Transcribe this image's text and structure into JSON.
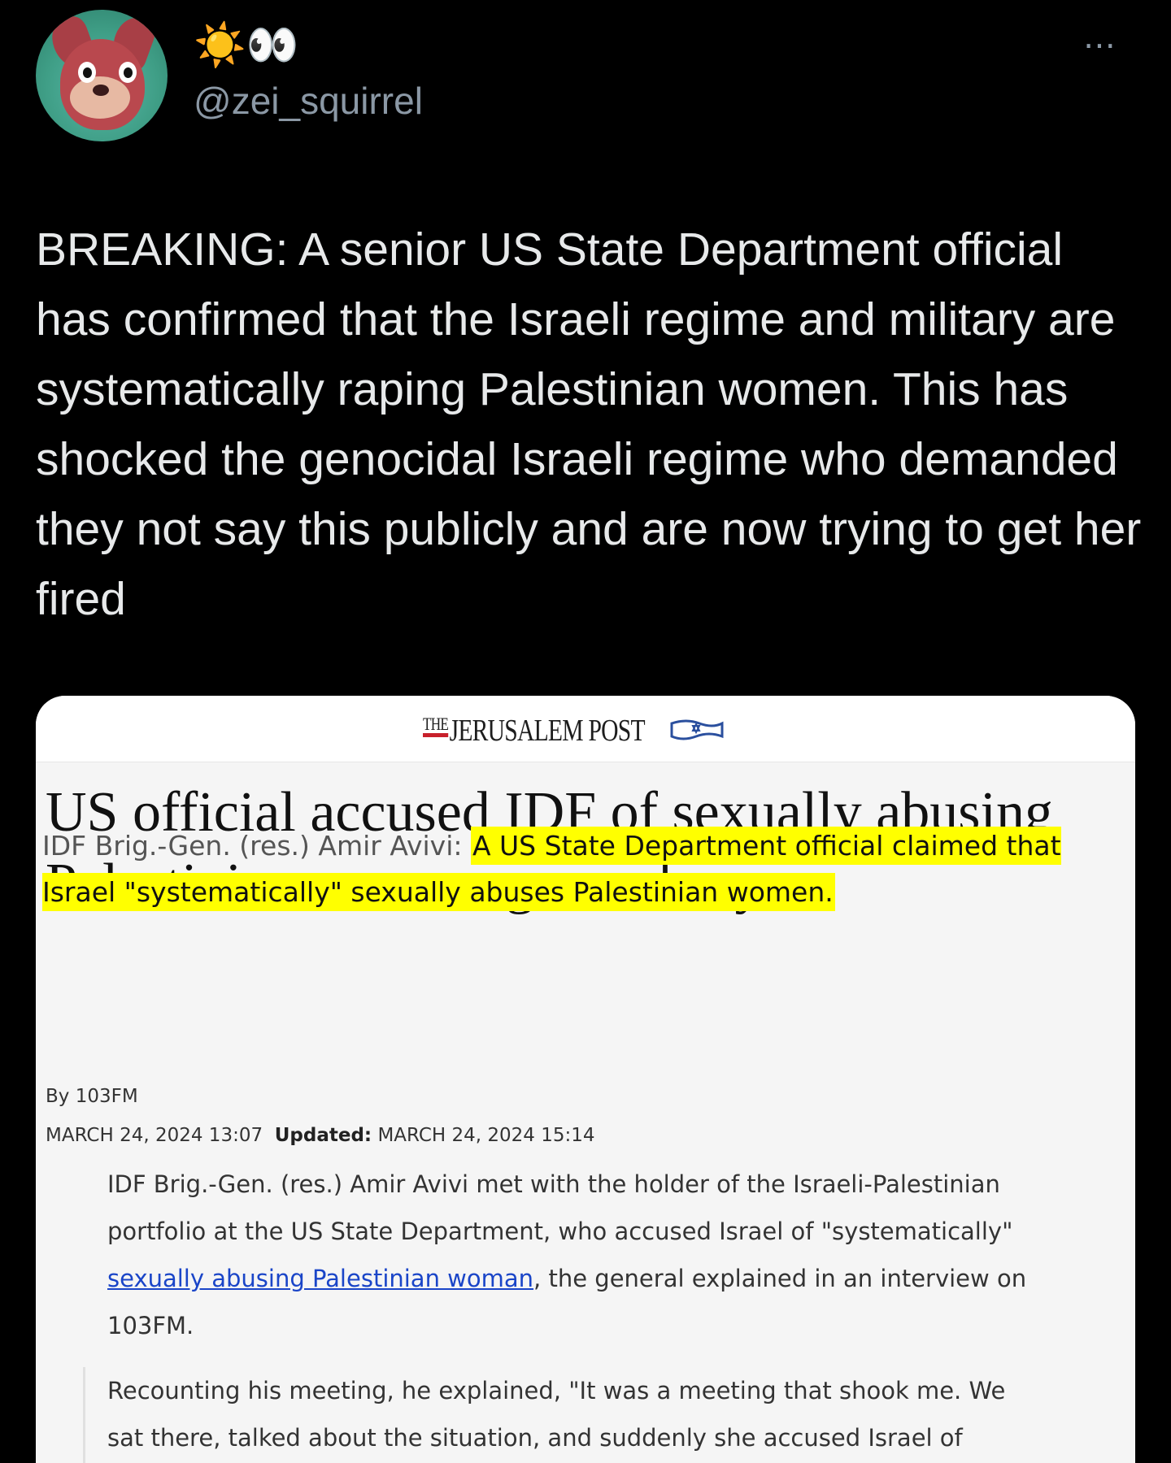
{
  "header": {
    "display_name": "☀️👀",
    "handle": "@zei_squirrel",
    "more_icon": "⋯"
  },
  "tweet": {
    "text": "BREAKING: A senior US State Department official has confirmed that the Israeli regime and military are systematically raping Palestinian women. This has shocked the genocidal Israeli regime who demanded they not say this publicly and are now trying to get her fired"
  },
  "card": {
    "logo_the": "THE",
    "logo_name": "JERUSALEM POST",
    "headline": "US official accused IDF of sexually abusing Palestinian women, general says",
    "sub_prefix": "IDF Brig.-Gen. (res.) Amir Avivi: ",
    "sub_highlight": "A US State Department official claimed that Israel \"systematically\" sexually abuses Palestinian women.",
    "byline": "By 103FM",
    "published": "MARCH 24, 2024 13:07",
    "updated_label": "Updated:",
    "updated": "MARCH 24, 2024 15:14",
    "p1_before": "IDF Brig.-Gen. (res.) Amir Avivi met with the holder of the Israeli-Palestinian portfolio at the US State Department, who accused Israel of \"systematically\" ",
    "p1_link": "sexually abusing Palestinian woman",
    "p1_after": ", the general explained in an interview on 103FM.",
    "p2": "Recounting his meeting, he explained, \"It was a meeting that shook me. We sat there, talked about the situation, and suddenly she accused Israel of"
  },
  "colors": {
    "background": "#000000",
    "text_primary": "#e7e9ea",
    "text_secondary": "#8b98a5",
    "highlight": "#ffff00",
    "link": "#1a45c8",
    "brand_red": "#c8202b"
  }
}
